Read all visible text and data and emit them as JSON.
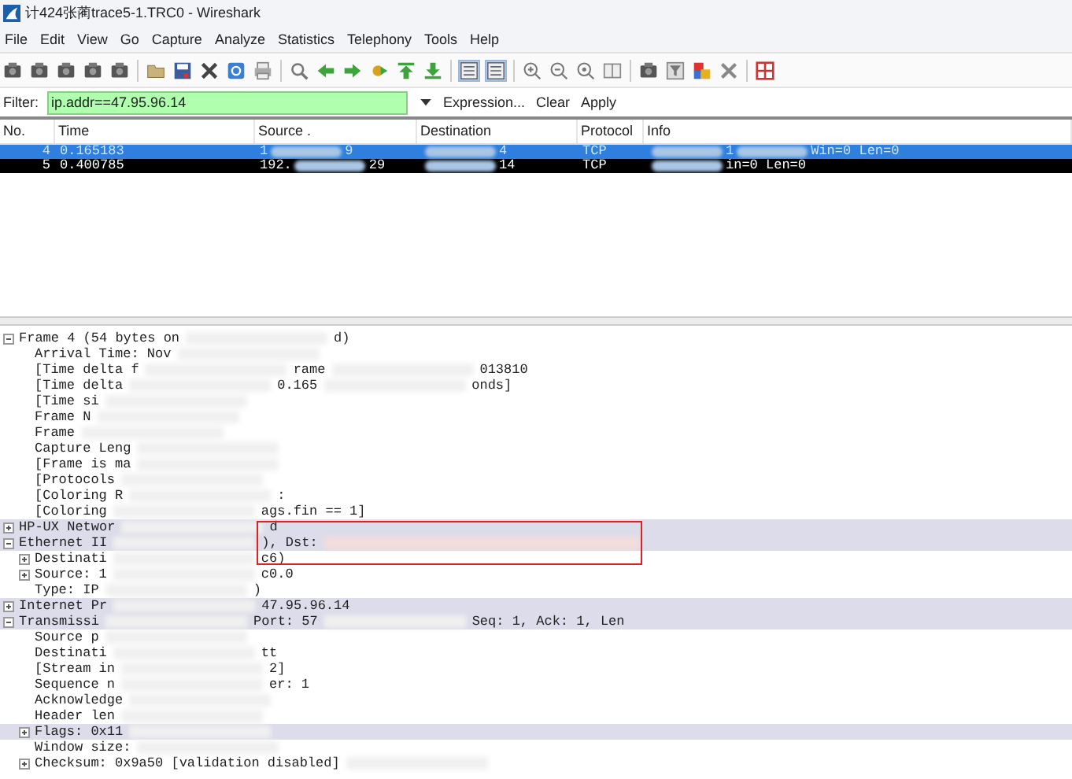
{
  "window": {
    "title": "计424张蔺trace5-1.TRC0 - Wireshark"
  },
  "menu": [
    "File",
    "Edit",
    "View",
    "Go",
    "Capture",
    "Analyze",
    "Statistics",
    "Telephony",
    "Tools",
    "Help"
  ],
  "toolbar": [
    {
      "kind": "capture"
    },
    {
      "kind": "capture"
    },
    {
      "kind": "capture"
    },
    {
      "kind": "capture"
    },
    {
      "kind": "capture"
    },
    {
      "kind": "sep"
    },
    {
      "kind": "folder"
    },
    {
      "kind": "save"
    },
    {
      "kind": "close"
    },
    {
      "kind": "reload"
    },
    {
      "kind": "print"
    },
    {
      "kind": "sep"
    },
    {
      "kind": "find"
    },
    {
      "kind": "back"
    },
    {
      "kind": "forward"
    },
    {
      "kind": "goto"
    },
    {
      "kind": "top"
    },
    {
      "kind": "bottom"
    },
    {
      "kind": "sep"
    },
    {
      "kind": "list"
    },
    {
      "kind": "list"
    },
    {
      "kind": "sep"
    },
    {
      "kind": "zoomin"
    },
    {
      "kind": "zoomout"
    },
    {
      "kind": "zoomreset"
    },
    {
      "kind": "columns"
    },
    {
      "kind": "sep"
    },
    {
      "kind": "capture"
    },
    {
      "kind": "filter"
    },
    {
      "kind": "colors"
    },
    {
      "kind": "tools"
    },
    {
      "kind": "sep"
    },
    {
      "kind": "help"
    }
  ],
  "filter": {
    "label": "Filter:",
    "value": "ip.addr==47.95.96.14",
    "actions": [
      "Expression...",
      "Clear",
      "Apply"
    ]
  },
  "packet_list": {
    "columns": [
      "No.",
      "Time",
      "Source .",
      "Destination",
      "Protocol",
      "Info"
    ],
    "rows": [
      {
        "selected": true,
        "cells": [
          [
            "4"
          ],
          [
            "0.165183"
          ],
          [
            "1",
            "9"
          ],
          [
            "",
            "4"
          ],
          [
            "TCP"
          ],
          [
            "",
            "1",
            "Win=0 Len=0"
          ]
        ]
      },
      {
        "selected": false,
        "cells": [
          [
            "5"
          ],
          [
            "0.400785"
          ],
          [
            "192.",
            "29"
          ],
          [
            "",
            "14"
          ],
          [
            "TCP"
          ],
          [
            "",
            "in=0 Len=0"
          ]
        ]
      }
    ]
  },
  "details": [
    {
      "parts": [
        "Frame 4 (54 bytes on",
        "d)"
      ],
      "expanded": true,
      "highlighted": false,
      "children": [
        {
          "parts": [
            "Arrival Time: Nov"
          ]
        },
        {
          "parts": [
            "[Time delta f",
            "rame",
            "013810"
          ]
        },
        {
          "parts": [
            "[Time delta",
            "0.165",
            "onds]"
          ]
        },
        {
          "parts": [
            "[Time si"
          ]
        },
        {
          "parts": [
            "Frame N"
          ]
        },
        {
          "parts": [
            "Frame"
          ]
        },
        {
          "parts": [
            "Capture Leng"
          ]
        },
        {
          "parts": [
            "[Frame is ma"
          ]
        },
        {
          "parts": [
            "[Protocols"
          ]
        },
        {
          "parts": [
            "[Coloring R",
            ":"
          ]
        },
        {
          "parts": [
            "[Coloring",
            "ags.fin == 1]"
          ]
        }
      ]
    },
    {
      "parts": [
        "HP-UX Networ",
        "d"
      ],
      "expanded": false,
      "highlighted": true
    },
    {
      "parts": [
        "Ethernet II",
        "), Dst:"
      ],
      "expanded": true,
      "highlighted": true,
      "boxed": true,
      "children": [
        {
          "parts": [
            "Destinati",
            "c6)"
          ],
          "expanded": false
        },
        {
          "parts": [
            "Source: 1",
            "c0.0"
          ],
          "expanded": false
        },
        {
          "parts": [
            "Type: IP",
            ")"
          ]
        }
      ]
    },
    {
      "parts": [
        "Internet Pr",
        "47.95.96.14"
      ],
      "expanded": false,
      "highlighted": true
    },
    {
      "parts": [
        "Transmissi",
        "Port: 57",
        "Seq: 1, Ack: 1, Len"
      ],
      "expanded": true,
      "highlighted": true,
      "children": [
        {
          "parts": [
            "Source p"
          ]
        },
        {
          "parts": [
            "Destinati",
            "tt"
          ]
        },
        {
          "parts": [
            "[Stream in",
            "2]"
          ]
        },
        {
          "parts": [
            "Sequence n",
            "er: 1"
          ]
        },
        {
          "parts": [
            "Acknowledge"
          ]
        },
        {
          "parts": [
            "Header len"
          ]
        },
        {
          "parts": [
            "Flags: 0x11"
          ],
          "expanded": false,
          "highlighted": true
        },
        {
          "parts": [
            "Window size:"
          ]
        },
        {
          "parts": [
            "Checksum: 0x9a50 [validation disabled]"
          ],
          "expanded": false
        }
      ]
    }
  ]
}
